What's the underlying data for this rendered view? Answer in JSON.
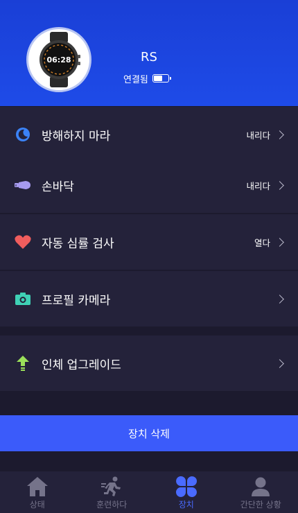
{
  "device": {
    "name": "RS",
    "status": "연결됨",
    "battery_level": 0.6,
    "watch_time": "06:28"
  },
  "menu": [
    {
      "label": "방해하지 마라",
      "value": "내리다",
      "icon": "moon-icon",
      "color": "#3b82f6"
    },
    {
      "label": "손바닥",
      "value": "내리다",
      "icon": "palm-icon",
      "color": "#a79bf0"
    },
    {
      "label": "자동 심률 검사",
      "value": "열다",
      "icon": "heart-icon",
      "color": "#f05d5d"
    },
    {
      "label": "프로필 카메라",
      "value": "",
      "icon": "camera-icon",
      "color": "#3fd1b5"
    },
    {
      "label": "인체 업그레이드",
      "value": "",
      "icon": "upgrade-arrow-icon",
      "color": "#9be05a"
    }
  ],
  "delete_label": "장치 삭제",
  "tabs": [
    {
      "label": "상태",
      "icon": "home-icon",
      "active": false
    },
    {
      "label": "훈련하다",
      "icon": "running-icon",
      "active": false
    },
    {
      "label": "장치",
      "icon": "device-clover-icon",
      "active": true
    },
    {
      "label": "간단한 상황",
      "icon": "person-icon",
      "active": false
    }
  ],
  "colors": {
    "header": "#1e4be8",
    "background": "#1c1a2e",
    "row": "#24223a",
    "accent": "#3b5bfa",
    "tab_inactive": "#75738a",
    "tab_active": "#4a6bff"
  }
}
